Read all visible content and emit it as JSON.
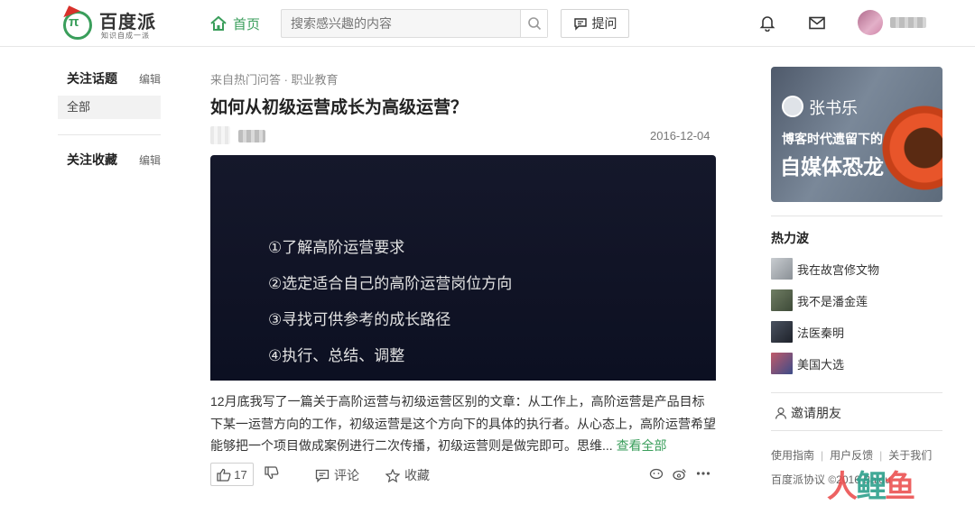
{
  "header": {
    "logo_text": "百度派",
    "logo_sub": "知识自成一派",
    "home_label": "首页",
    "search_placeholder": "搜索感兴趣的内容",
    "ask_label": "提问"
  },
  "left": {
    "topics_title": "关注话题",
    "topics_edit": "编辑",
    "topics_all": "全部",
    "favorites_title": "关注收藏",
    "favorites_edit": "编辑"
  },
  "post": {
    "source": "来自热门问答 · 职业教育",
    "title": "如何从初级运营成长为高级运营？",
    "date": "2016-12-04",
    "cover_items": [
      "①了解高阶运营要求",
      "②选定适合自己的高阶运营岗位方向",
      "③寻找可供参考的成长路径",
      "④执行、总结、调整"
    ],
    "excerpt": "12月底我写了一篇关于高阶运营与初级运营区别的文章：从工作上，高阶运营是产品目标下某一运营方向的工作，初级运营是这个方向下的具体的执行者。从心态上，高阶运营希望能够把一个项目做成案例进行二次传播，初级运营则是做完即可。思维...",
    "more_label": "查看全部",
    "likes": "17",
    "comment_label": "评论",
    "favorite_label": "收藏"
  },
  "right": {
    "banner_name": "张书乐",
    "banner_line1": "博客时代遗留下的",
    "banner_line2": "自媒体恐龙",
    "hot_title": "热力波",
    "hot_items": [
      {
        "label": "我在故宫修文物",
        "color": "#9aa0a6"
      },
      {
        "label": "我不是潘金莲",
        "color": "#5b6b52"
      },
      {
        "label": "法医秦明",
        "color": "#2e3440"
      },
      {
        "label": "美国大选",
        "color": "#7a4a5a"
      }
    ],
    "invite_label": "邀请朋友",
    "footer_links": [
      "使用指南",
      "用户反馈",
      "关于我们"
    ],
    "footer_copy": "百度派协议 ©2016 Baidu"
  },
  "watermark": {
    "text_a": "人",
    "text_b": "鲤",
    "text_c": "鱼"
  },
  "colors": {
    "accent": "#3a9e5b",
    "text": "#333333",
    "cover_bg": "#12152a"
  }
}
